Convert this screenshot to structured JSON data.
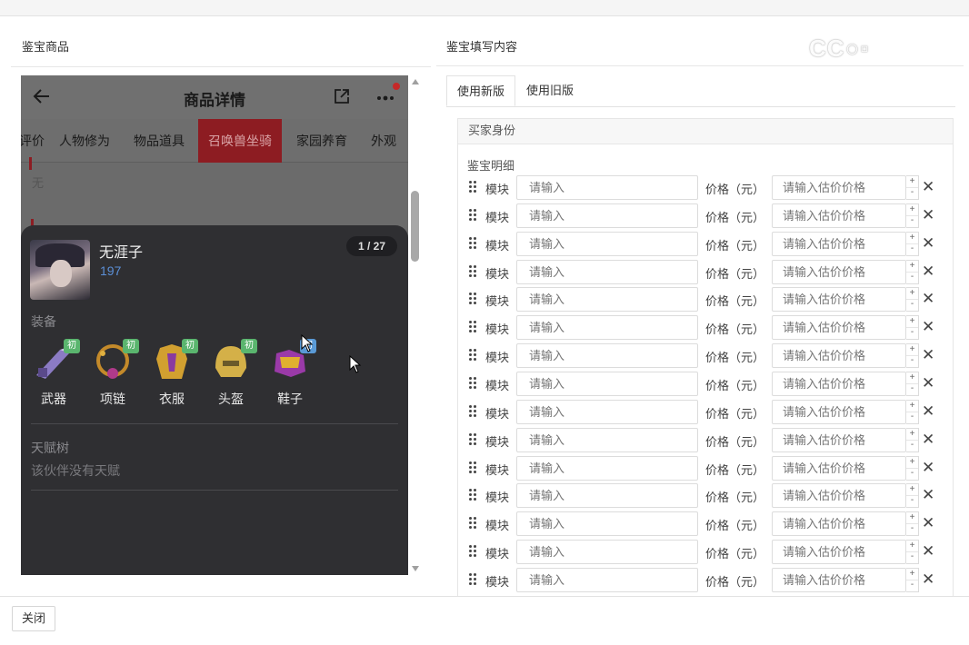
{
  "left": {
    "title": "鉴宝商品"
  },
  "right": {
    "title": "鉴宝填写内容"
  },
  "watermark": "CC",
  "phone": {
    "header_title": "商品详情",
    "tabs": [
      "评价",
      "人物修为",
      "物品道具",
      "召唤兽坐骑",
      "家园养育",
      "外观"
    ],
    "active_tab": "召唤兽坐骑",
    "bg_text": "无",
    "character": {
      "name": "无涯子",
      "level": "197",
      "pager": "1 / 27"
    },
    "equipment_label": "装备",
    "equipment": [
      {
        "label": "武器",
        "badge": "初"
      },
      {
        "label": "项链",
        "badge": "初"
      },
      {
        "label": "衣服",
        "badge": "初"
      },
      {
        "label": "头盔",
        "badge": "初"
      },
      {
        "label": "鞋子",
        "badge": "初"
      }
    ],
    "talent_label": "天赋树",
    "talent_note": "该伙伴没有天赋"
  },
  "tabs": {
    "new": "使用新版",
    "old": "使用旧版"
  },
  "card": {
    "header": "买家身份",
    "detail_label": "鉴宝明细"
  },
  "row_template": {
    "module_label": "模块",
    "module_placeholder": "请输入",
    "price_label": "价格（元）",
    "price_placeholder": "请输入估价价格",
    "plus": "+",
    "minus": "-",
    "remove": "✕"
  },
  "row_count": 15,
  "footer": {
    "close_label": "关闭"
  },
  "colors": {
    "active_tab": "#8d1c22",
    "level": "#5b8fd6",
    "badge": "#5ab56e",
    "badge_alt": "#5a9ad6"
  }
}
